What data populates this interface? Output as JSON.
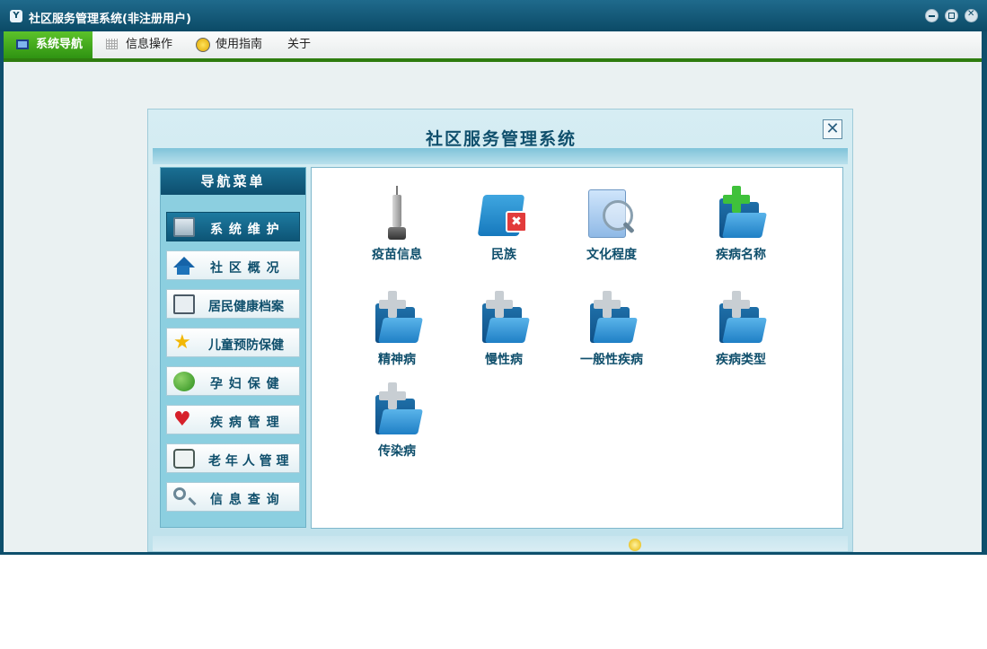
{
  "window": {
    "title": "社区服务管理系统(非注册用户)",
    "app_icon_text": "Y"
  },
  "menubar": {
    "items": [
      {
        "label": "系统导航",
        "icon": "monitor-icon",
        "active": true
      },
      {
        "label": "信息操作",
        "icon": "grid-icon",
        "active": false
      },
      {
        "label": "使用指南",
        "icon": "bulb-icon",
        "active": false
      },
      {
        "label": "关于",
        "icon": "",
        "active": false
      }
    ]
  },
  "dialog": {
    "title": "社区服务管理系统",
    "close_label": "✕"
  },
  "nav": {
    "header": "导航菜单",
    "items": [
      {
        "label": "系 统 维 护",
        "icon": "monitor-icon",
        "selected": true
      },
      {
        "label": "社 区 概 况",
        "icon": "home-icon",
        "selected": false
      },
      {
        "label": "居民健康档案",
        "icon": "document-icon",
        "selected": false
      },
      {
        "label": "儿童预防保健",
        "icon": "star-icon",
        "selected": false
      },
      {
        "label": "孕 妇 保 健",
        "icon": "people-icon",
        "selected": false
      },
      {
        "label": "疾 病 管 理",
        "icon": "heart-icon",
        "selected": false
      },
      {
        "label": "老 年 人 管 理",
        "icon": "id-card-icon",
        "selected": false
      },
      {
        "label": "信 息 查 询",
        "icon": "search-icon",
        "selected": false
      }
    ]
  },
  "tiles": [
    {
      "label": "疫苗信息",
      "icon": "syringe-icon"
    },
    {
      "label": "民族",
      "icon": "folder-tools-icon"
    },
    {
      "label": "文化程度",
      "icon": "magnifier-icon"
    },
    {
      "label": "疾病名称",
      "icon": "folder-plus-green-icon"
    },
    {
      "label": "精神病",
      "icon": "folder-plus-icon"
    },
    {
      "label": "慢性病",
      "icon": "folder-plus-icon"
    },
    {
      "label": "一般性疾病",
      "icon": "folder-plus-icon"
    },
    {
      "label": "疾病类型",
      "icon": "folder-plus-icon"
    },
    {
      "label": "传染病",
      "icon": "folder-plus-icon"
    }
  ],
  "colors": {
    "titlebar": "#0b4a66",
    "menu_active": "#2f9312",
    "accent_text": "#0f4f6c"
  }
}
